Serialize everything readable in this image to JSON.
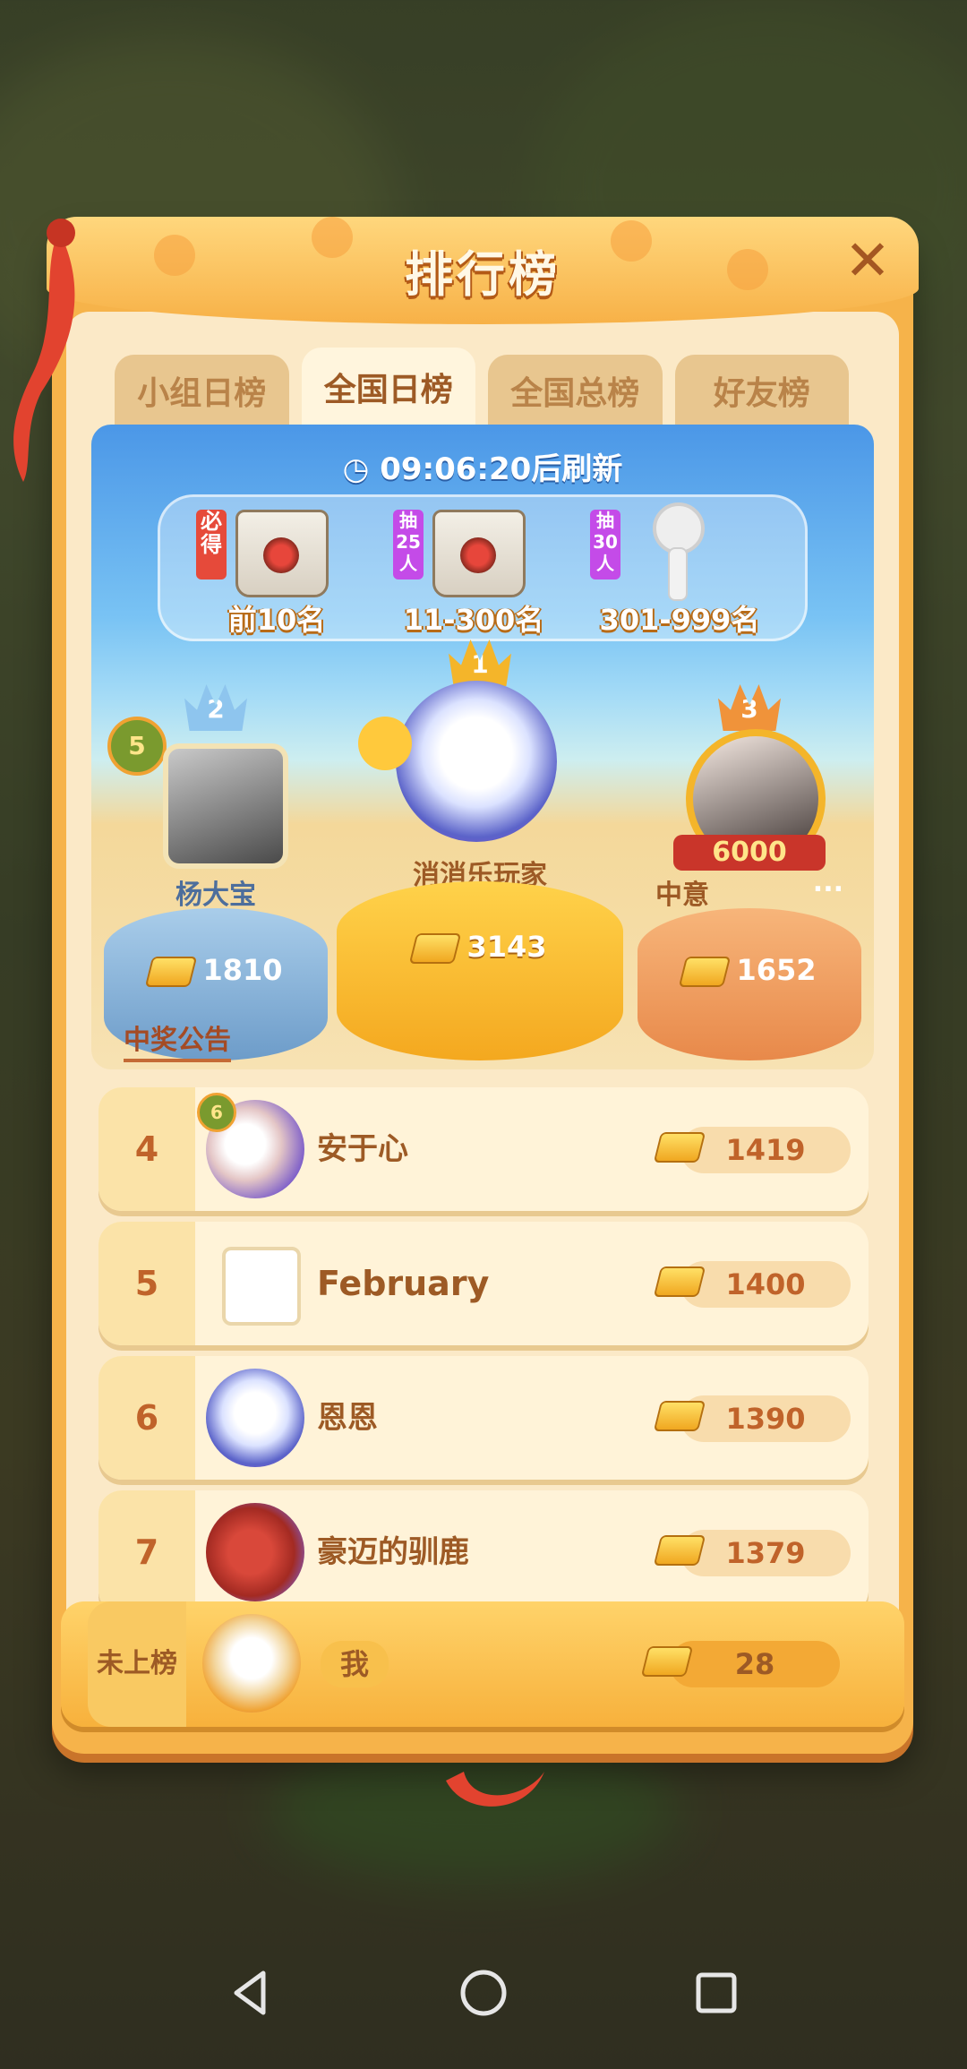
{
  "title": "排行榜",
  "tabs": [
    {
      "label": "小组日榜"
    },
    {
      "label": "全国日榜"
    },
    {
      "label": "全国总榜"
    },
    {
      "label": "好友榜"
    }
  ],
  "active_tab": "全国日榜",
  "refresh": {
    "time": "09:06:20",
    "suffix": "后刷新"
  },
  "prizes": [
    {
      "tag": "必得",
      "range": "前10名"
    },
    {
      "tag": "抽25人",
      "range": "11-300名"
    },
    {
      "tag": "抽30人",
      "range": "301-999名"
    }
  ],
  "podium": [
    {
      "rank": "1",
      "name": "消消乐玩家",
      "score": "3143"
    },
    {
      "rank": "2",
      "name": "杨大宝",
      "score": "1810",
      "level": "5"
    },
    {
      "rank": "3",
      "name": "中意",
      "more": "...",
      "score": "1652",
      "badge": "6000"
    }
  ],
  "announcement": "中奖公告",
  "list": [
    {
      "rank": "4",
      "name": "安于心",
      "score": "1419",
      "level": "6"
    },
    {
      "rank": "5",
      "name": "February",
      "score": "1400"
    },
    {
      "rank": "6",
      "name": "恩恩",
      "score": "1390"
    },
    {
      "rank": "7",
      "name": "豪迈的驯鹿",
      "score": "1379"
    }
  ],
  "me": {
    "rank": "未上榜",
    "name": "我",
    "score": "28"
  },
  "colors": {
    "panel": "#f6b34a",
    "accent": "#c0632a",
    "sky": "#4b97e7"
  }
}
